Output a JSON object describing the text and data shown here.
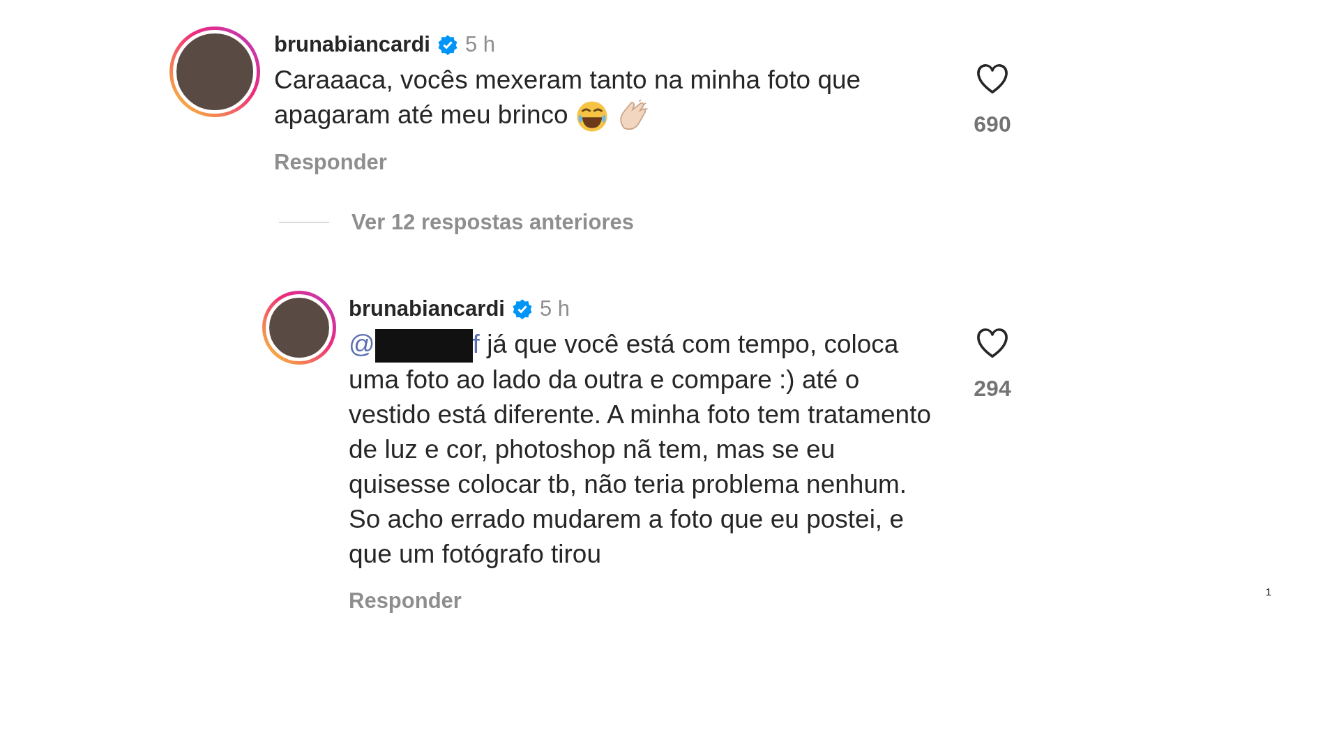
{
  "comments": [
    {
      "username": "brunabiancardi",
      "verified": true,
      "time": "5 h",
      "text": "Caraaaca, vocês mexeram tanto na minha foto que apagaram até meu brinco",
      "emojis": [
        {
          "kind": "laughing"
        },
        {
          "kind": "clapping"
        }
      ],
      "likes": "690",
      "liked": false,
      "reply": "Responder",
      "nested": false
    },
    {
      "username": "brunabiancardi",
      "verified": true,
      "time": "5 h",
      "mention_start": "@",
      "mention_end": "f",
      "redacted": true,
      "text": "já que você está com tempo, coloca uma foto ao lado da outra e compare :) até o vestido está diferente. A minha foto tem tratamento de luz e cor, photoshop nã tem, mas se eu quisesse colocar tb, não teria problema nenhum. So acho errado mudarem a foto que eu postei, e que um fotógrafo tirou",
      "likes": "294",
      "liked": false,
      "reply": "Responder",
      "nested": true
    }
  ],
  "view_replies": "Ver 12 respostas anteriores",
  "slide_number": "1"
}
